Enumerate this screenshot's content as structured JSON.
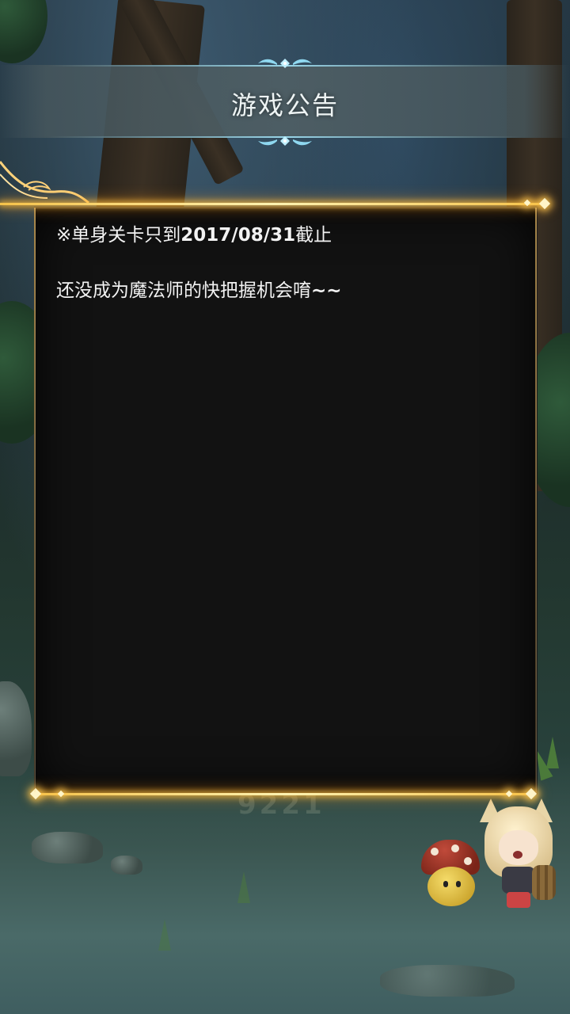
{
  "header": {
    "title": "游戏公告"
  },
  "notice": {
    "line1_prefix": "※单身关卡只到",
    "line1_date": "2017/08/31",
    "line1_suffix": "截止",
    "line2_main": "还没成为魔法师的快把握机会唷",
    "line2_tilde": "~~"
  },
  "background": {
    "faint_text": "9221"
  },
  "colors": {
    "frame_gold": "#f5c24a",
    "banner_glow": "#a0e1f5",
    "panel_bg": "#121212",
    "text": "#f2f2f2"
  },
  "icons": [
    "banner-ornament-icon",
    "gold-diamond-icon",
    "corner-swirl-icon"
  ]
}
